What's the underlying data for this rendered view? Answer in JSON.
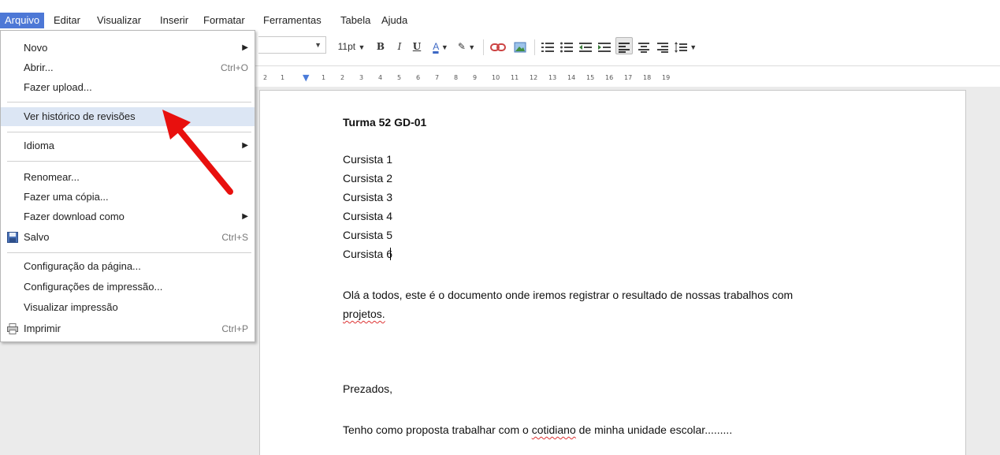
{
  "menubar": {
    "items": [
      "Arquivo",
      "Editar",
      "Visualizar",
      "Inserir",
      "Formatar",
      "Ferramentas",
      "Tabela",
      "Ajuda"
    ]
  },
  "toolbar": {
    "font_size": "11pt",
    "bold": "B",
    "italic": "I",
    "underline": "U",
    "text_color": "A"
  },
  "ruler": {
    "ticks": [
      "2",
      "1",
      "1",
      "2",
      "3",
      "4",
      "5",
      "6",
      "7",
      "8",
      "9",
      "10",
      "11",
      "12",
      "13",
      "14",
      "15",
      "16",
      "17",
      "18",
      "19"
    ]
  },
  "file_menu": {
    "new_label": "Novo",
    "open_label": "Abrir...",
    "open_shortcut": "Ctrl+O",
    "upload_label": "Fazer upload...",
    "revisions_label": "Ver histórico de revisões",
    "language_label": "Idioma",
    "rename_label": "Renomear...",
    "copy_label": "Fazer uma cópia...",
    "download_label": "Fazer download como",
    "saved_label": "Salvo",
    "saved_shortcut": "Ctrl+S",
    "page_setup_label": "Configuração da página...",
    "print_settings_label": "Configurações de impressão...",
    "print_preview_label": "Visualizar impressão",
    "print_label": "Imprimir",
    "print_shortcut": "Ctrl+P"
  },
  "document": {
    "title": "Turma 52 GD-01",
    "students": [
      "Cursista 1",
      "Cursista 2",
      "Cursista 3",
      "Cursista 4",
      "Cursista 5"
    ],
    "last_student_prefix": "Cursista ",
    "last_student_digit": "6",
    "para1_line1": "Olá a todos, este é o documento  onde iremos registrar o resultado de nossas trabalhos com",
    "para1_line2": "projetos.",
    "greeting": "Prezados,",
    "proposal_before": "Tenho como proposta trabalhar com o ",
    "proposal_word": "cotidiano",
    "proposal_after": " de minha unidade escolar........."
  },
  "colors": {
    "menu_active": "#4d78d6",
    "menu_highlight": "#dce6f4",
    "annotation_arrow": "#e8100e",
    "workspace": "#ebebeb"
  }
}
